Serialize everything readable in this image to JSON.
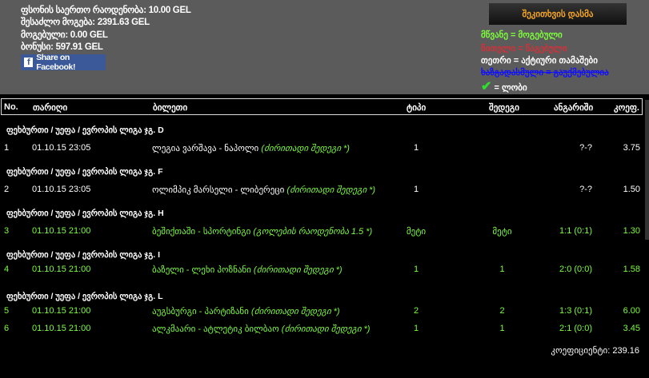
{
  "summary": {
    "total_stake": "ფსონის საერთო რაოდენობა: 10.00 GEL",
    "possible_win": "შესაძლო მოგება: 2391.63 GEL",
    "won": "მოგებული: 0.00 GEL",
    "bonus": "ბონუსი: 597.91 GEL",
    "share_label": "Share on Facebook!"
  },
  "ask_button": "შეკითხვის დასმა",
  "legend": {
    "green": "მწვანე = მოგებული",
    "red": "წითელი = წაგებული",
    "white": "თეთრი = აქტიური თამაშები",
    "strike": "ხაზგადასმული = გაუქმებულია",
    "check": "= ლობი"
  },
  "colors": {
    "green": "#7cfc3c",
    "red": "#d0323a",
    "blue": "#1010ff",
    "accent": "#f5a623"
  },
  "columns": [
    "No.",
    "თარიღი",
    "ბილეთი",
    "ტიპი",
    "შედეგი",
    "ანგარიში",
    "კოეფ."
  ],
  "groups": [
    "ფეხბურთი / უეფა / ევროპის ლიგა ჯგ. D",
    "ფეხბურთი / უეფა / ევროპის ლიგა ჯგ. F",
    "ფეხბურთი / უეფა / ევროპის ლიგა ჯგ. H",
    "ფეხბურთი / უეფა / ევროპის ლიგა ჯგ. I",
    "ფეხბურთი / უეფა / ევროპის ლიგა ჯგ. L"
  ],
  "rows": [
    {
      "no": "1",
      "date": "01.10.15 23:05",
      "match": "ლეგია ვარშავა - ნაპოლი",
      "market": "(ძირითადი შედეგი *)",
      "type": "1",
      "result": "",
      "score": "?-?",
      "odds": "3.75"
    },
    {
      "no": "2",
      "date": "01.10.15 23:05",
      "match": "ოლიმპიკ მარსელი - ლიბერეცი",
      "market": "(ძირითადი შედეგი *)",
      "type": "1",
      "result": "",
      "score": "?-?",
      "odds": "1.50"
    },
    {
      "no": "3",
      "date": "01.10.15 21:00",
      "match": "ბეშიქთაში - სპორტინგი",
      "market": "(გოლების რაოდენობა 1.5 *)",
      "type": "მეტი",
      "result": "მეტი",
      "score": "1:1 (0:1)",
      "odds": "1.30"
    },
    {
      "no": "4",
      "date": "01.10.15 21:00",
      "match": "ბაზელი - ლეხი პოზნანი",
      "market": "(ძირითადი შედეგი *)",
      "type": "1",
      "result": "1",
      "score": "2:0 (0:0)",
      "odds": "1.58"
    },
    {
      "no": "5",
      "date": "01.10.15 21:00",
      "match": "აუგსბურგი - პარტიზანი",
      "market": "(ძირითადი შედეგი *)",
      "type": "2",
      "result": "2",
      "score": "1:3 (0:1)",
      "odds": "6.00"
    },
    {
      "no": "6",
      "date": "01.10.15 21:00",
      "match": "ალკმაარი - ატლეტიკ ბილბაო",
      "market": "(ძირითადი შედეგი *)",
      "type": "1",
      "result": "1",
      "score": "2:1 (0:0)",
      "odds": "3.45"
    }
  ],
  "total": "კოეფიციენტი: 239.16"
}
